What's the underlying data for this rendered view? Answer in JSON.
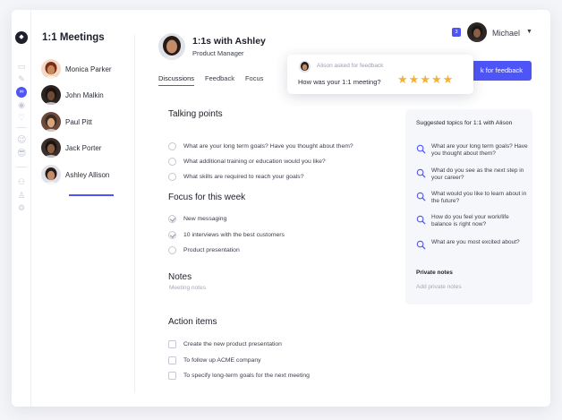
{
  "sidebar": {
    "title": "1:1 Meetings",
    "people": [
      {
        "name": "Monica Parker",
        "skin": "#c98a5a",
        "hair": "#7a2d1a",
        "bg": "#f4d9c7"
      },
      {
        "name": "John Malkin",
        "skin": "#6d4b36",
        "hair": "#1c1410",
        "bg": "#2a2322"
      },
      {
        "name": "Paul Pitt",
        "skin": "#d6a57c",
        "hair": "#3b2a20",
        "bg": "#6b4a3a"
      },
      {
        "name": "Jack Porter",
        "skin": "#8a5f45",
        "hair": "#1b1512",
        "bg": "#3b2f2b"
      },
      {
        "name": "Ashley Allison",
        "skin": "#c28b69",
        "hair": "#251a16",
        "bg": "#dfe2e8"
      }
    ],
    "emoji_1": "😉",
    "emoji_2": "😎"
  },
  "header": {
    "title": "1:1s with Ashley",
    "subtitle": "Product Manager",
    "tabs": [
      "Discussions",
      "Feedback",
      "Focus"
    ]
  },
  "user": {
    "name": "Michael",
    "notification_count": "3"
  },
  "feedback_button": "k for feedback",
  "popover": {
    "meta": "Alison asked for feedback",
    "question": "How was your 1:1 meeting?",
    "rating": 5
  },
  "talking_points": {
    "title": "Talking points",
    "items": [
      "What are your long term goals? Have you thought about them?",
      "What additional training or education would you like?",
      "What skills are required to reach your goals?"
    ]
  },
  "focus": {
    "title": "Focus for this week",
    "items": [
      {
        "text": "New messaging",
        "done": true
      },
      {
        "text": "10 interviews with the best customers",
        "done": true
      },
      {
        "text": "Product presentation",
        "done": false
      }
    ]
  },
  "notes": {
    "title": "Notes",
    "placeholder": "Meeting notes"
  },
  "action_items": {
    "title": "Action items",
    "items": [
      "Create the new product presentation",
      "To follow up ACME company",
      "To specify long-term goals for the next meeting"
    ]
  },
  "suggestions": {
    "title": "Suggested topics for 1:1 with Alison",
    "items": [
      "What are your long term goals? Have you thought about them?",
      "What do you see as the next step in your career?",
      "What would you like to learn about in the future?",
      "How do you feel your work/life balance is right now?",
      "What are you most excited about?"
    ],
    "private_title": "Private notes",
    "private_placeholder": "Add private notes"
  },
  "colors": {
    "accent": "#4e55f7",
    "star": "#f2b233"
  }
}
